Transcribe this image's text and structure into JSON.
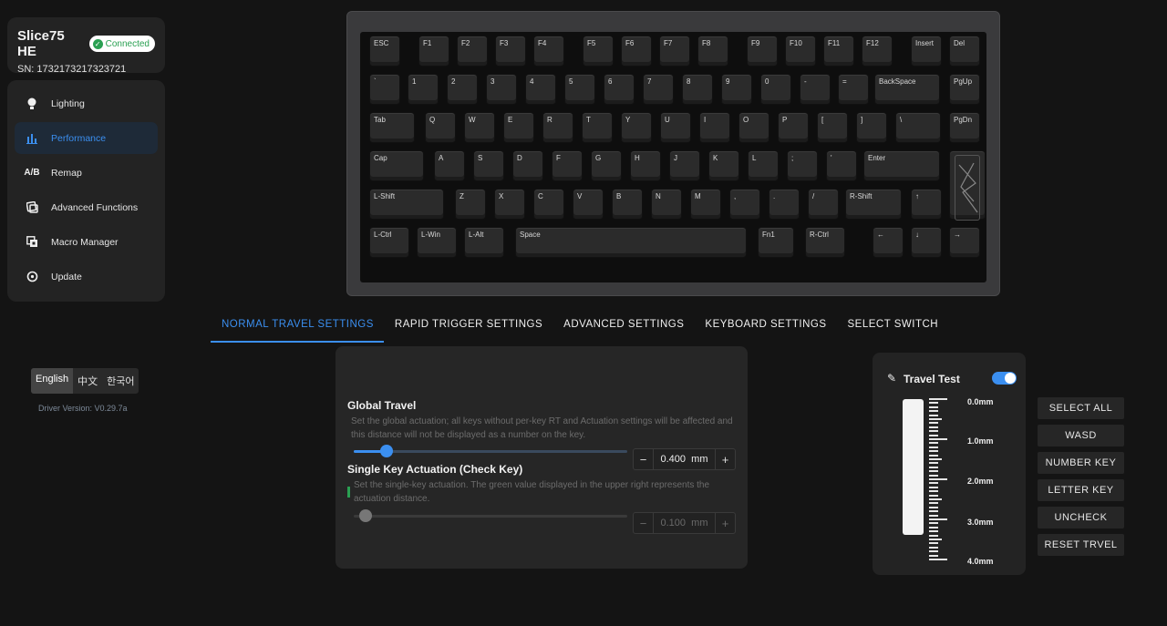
{
  "device": {
    "name": "Slice75 HE",
    "status": "Connected",
    "sn": "SN: 1732173217323721"
  },
  "nav": [
    {
      "label": "Lighting",
      "icon": "bulb-icon",
      "glyph": "💡"
    },
    {
      "label": "Performance",
      "icon": "bar-chart-icon",
      "glyph": "📊"
    },
    {
      "label": "Remap",
      "icon": "remap-icon",
      "glyph": "⇄"
    },
    {
      "label": "Advanced Functions",
      "icon": "advanced-icon",
      "glyph": "⚙"
    },
    {
      "label": "Macro Manager",
      "icon": "macro-icon",
      "glyph": "▣"
    },
    {
      "label": "Update",
      "icon": "update-icon",
      "glyph": "↻"
    }
  ],
  "languages": [
    "English",
    "中文",
    "한국어"
  ],
  "driver_version": "Driver Version:  V0.29.7a",
  "tabs": [
    "NORMAL TRAVEL SETTINGS",
    "RAPID TRIGGER SETTINGS",
    "ADVANCED SETTINGS",
    "KEYBOARD SETTINGS",
    "SELECT SWITCH"
  ],
  "global_travel": {
    "title": "Global Travel",
    "desc": "Set the global actuation; all keys without per-key RT and Actuation settings will be affected and this distance will not be displayed as a number on the key.",
    "value": "0.400",
    "unit": "mm",
    "slider_fraction": 0.12
  },
  "single_key": {
    "title": "Single Key Actuation  (Check Key)",
    "desc": "Set the single-key actuation. The green value displayed in the upper right represents the actuation distance.",
    "value": "0.100",
    "unit": "mm",
    "slider_fraction": 0.02
  },
  "travel_test": {
    "title": "Travel Test",
    "enabled": true,
    "labels": [
      "0.0mm",
      "1.0mm",
      "2.0mm",
      "3.0mm",
      "4.0mm"
    ]
  },
  "quick_buttons": [
    "SELECT ALL",
    "WASD",
    "NUMBER KEY",
    "LETTER KEY",
    "UNCHECK",
    "RESET TRVEL"
  ],
  "keys": {
    "row0": [
      "ESC",
      "F1",
      "F2",
      "F3",
      "F4",
      "F5",
      "F6",
      "F7",
      "F8",
      "F9",
      "F10",
      "F11",
      "F12",
      "Insert",
      "Del"
    ],
    "row1": [
      "`",
      "1",
      "2",
      "3",
      "4",
      "5",
      "6",
      "7",
      "8",
      "9",
      "0",
      "-",
      "=",
      "BackSpace",
      "PgUp"
    ],
    "row2": [
      "Tab",
      "Q",
      "W",
      "E",
      "R",
      "T",
      "Y",
      "U",
      "I",
      "O",
      "P",
      "[",
      "]",
      "\\",
      "PgDn"
    ],
    "row3": [
      "Cap",
      "A",
      "S",
      "D",
      "F",
      "G",
      "H",
      "J",
      "K",
      "L",
      ";",
      "'",
      "Enter"
    ],
    "row4": [
      "L-Shift",
      "Z",
      "X",
      "C",
      "V",
      "B",
      "N",
      "M",
      ",",
      ".",
      "/",
      "R-Shift",
      "↑"
    ],
    "row5": [
      "L-Ctrl",
      "L-Win",
      "L-Alt",
      "Space",
      "Fn1",
      "R-Ctrl",
      "←",
      "↓",
      "→"
    ]
  }
}
